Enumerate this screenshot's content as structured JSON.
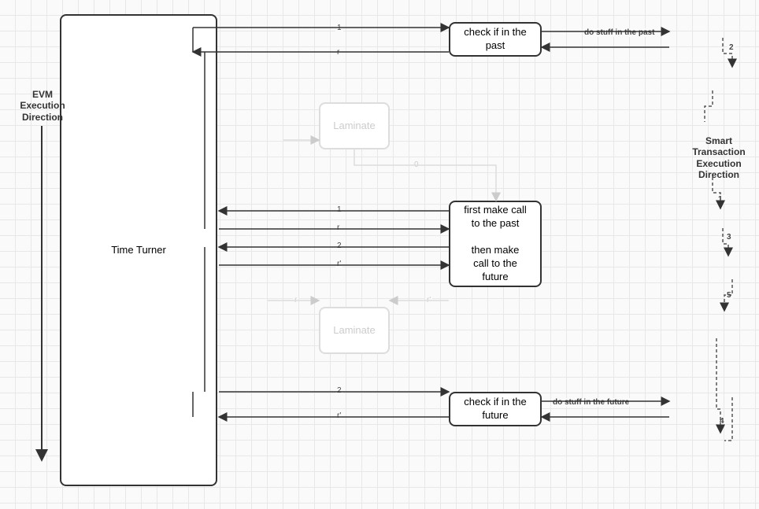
{
  "evm_label": "EVM\nExecution\nDirection",
  "smart_label": "Smart Transaction\nExecution Direction",
  "time_turner": "Time\nTurner",
  "box_past_check": "check if in the\npast",
  "box_middle": "first make call\nto the past\n\nthen make\ncall to the\nfuture",
  "box_future_check": "check if in the\nfuture",
  "laminate": "Laminate",
  "edge_past_stuff": "do stuff in the past",
  "edge_future_stuff": "do stuff in the future",
  "n1": "1",
  "n2": "2",
  "n3": "3",
  "n4": "4",
  "n5": "5",
  "n0": "0",
  "r": "r",
  "rp": "r'"
}
